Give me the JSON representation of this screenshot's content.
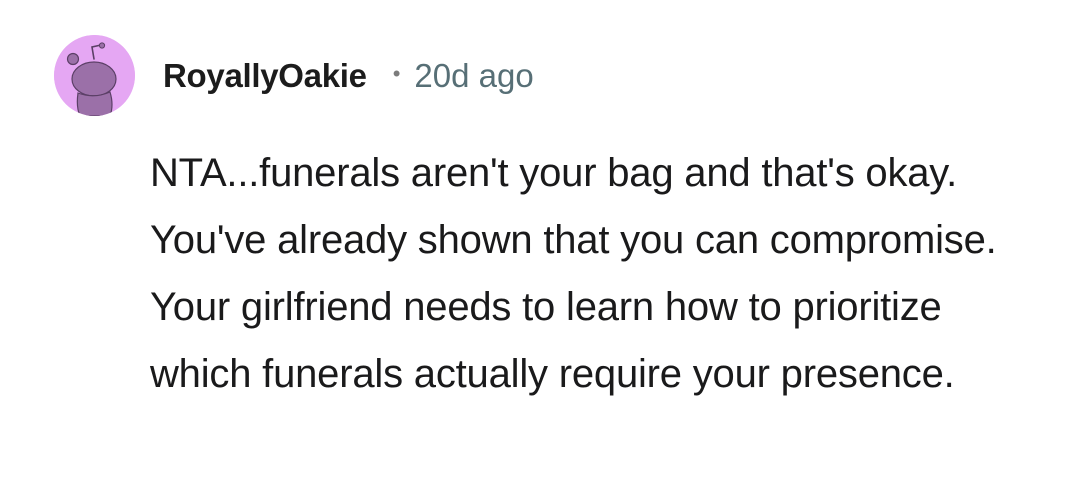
{
  "comment": {
    "author": "RoyallyOakie",
    "separator": "•",
    "age": "20d ago",
    "body": "NTA...funerals aren't your bag and that's okay. You've already shown that you can compromise. Your girlfriend needs to learn how to prioritize which funerals actually require your presence.",
    "avatar_icon": "snoo-avatar-icon"
  },
  "colors": {
    "avatar_background": "#e5a7f3",
    "avatar_figure": "#9b70a8",
    "username": "#1c1c1c",
    "timestamp": "#576f76",
    "body_text": "#1a1a1b",
    "background": "#ffffff"
  }
}
